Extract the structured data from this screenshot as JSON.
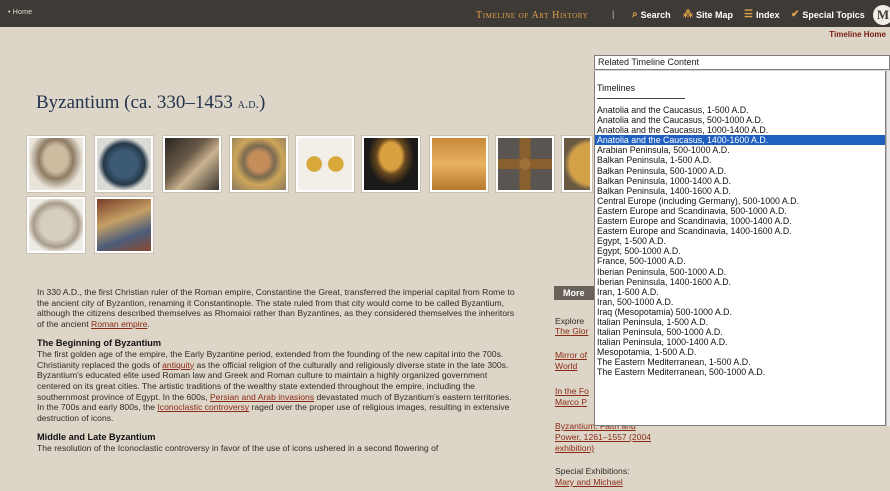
{
  "topbar": {
    "home": "• Home",
    "site_title": "Timeline of Art History",
    "separator": "|",
    "nav": [
      {
        "label": "Search",
        "icon": "⌕"
      },
      {
        "label": "Site Map",
        "icon": "⁂"
      },
      {
        "label": "Index",
        "icon": "☰"
      },
      {
        "label": "Special Topics",
        "icon": "✔"
      }
    ],
    "logo": "M",
    "timeline_home": "Timeline Home"
  },
  "title": {
    "main": "Byzantium (ca. 330–1453 ",
    "era": "a.d.",
    "close": ")"
  },
  "content": {
    "intro": {
      "a": "In 330 A.D., the first Christian ruler of the Roman empire, Constantine the Great, transferred the imperial capital from Rome to the ancient city of Byzantion, renaming it Constantinople. The state ruled from that city would come to be called Byzantium, although the citizens described themselves as Rhomaioi rather than Byzantines, as they considered themselves the inheritors of the ancient ",
      "link": "Roman empire",
      "b": "."
    },
    "section1": {
      "heading": "The Beginning of Byzantium",
      "a": "The first golden age of the empire, the Early Byzantine period, extended from the founding of the new capital into the 700s. Christianity replaced the gods of ",
      "link1": "antiquity",
      "b": " as the official religion of the culturally and religiously diverse state in the late 300s. Byzantium's educated elite used Roman law and Greek and Roman culture to maintain a highly organized government centered on its great cities. The artistic traditions of the wealthy state extended throughout the empire, including the southernmost province of Egypt. In the 600s, ",
      "link2": "Persian and Arab invasions",
      "c": " devastated much of Byzantium's eastern territories. In the 700s and early 800s, the ",
      "link3": "Iconoclastic controversy",
      "d": " raged over the proper use of religious images, resulting in extensive destruction of icons."
    },
    "section2": {
      "heading": "Middle and Late Byzantium",
      "a": "The resolution of the Iconoclastic controversy in favor of the use of icons ushered in a second flowering of"
    }
  },
  "right_column": {
    "more": "More",
    "explore": "Explore",
    "link_glory": "The Glor",
    "link_mirror": "Mirror of",
    "link_world": "World",
    "link_inthe": "In the Fo",
    "link_marco": "Marco P",
    "link_byz1": "Byzantium: Faith and",
    "link_byz2": "Power, 1261–1557 (2004",
    "link_byz3": "exhibition)",
    "special": "Special Exhibitions:",
    "link_mary": "Mary and Michael"
  },
  "dropdown": {
    "selected_value": "Related Timeline Content",
    "heading": "Timelines",
    "selected_index": 3,
    "options": [
      "Anatolia and the Caucasus, 1-500 A.D.",
      "Anatolia and the Caucasus, 500-1000 A.D.",
      "Anatolia and the Caucasus, 1000-1400 A.D.",
      "Anatolia and the Caucasus, 1400-1600 A.D.",
      "Arabian Peninsula, 500-1000 A.D.",
      "Balkan Peninsula, 1-500 A.D.",
      "Balkan Peninsula, 500-1000 A.D.",
      "Balkan Peninsula, 1000-1400 A.D.",
      "Balkan Peninsula, 1400-1600 A.D.",
      "Central Europe (including Germany), 500-1000 A.D.",
      "Eastern Europe and Scandinavia, 500-1000 A.D.",
      "Eastern Europe and Scandinavia, 1000-1400 A.D.",
      "Eastern Europe and Scandinavia, 1400-1600 A.D.",
      "Egypt, 1-500 A.D.",
      "Egypt, 500-1000 A.D.",
      "France, 500-1000 A.D.",
      "Iberian Peninsula, 500-1000 A.D.",
      "Iberian Peninsula, 1400-1600 A.D.",
      "Iran, 1-500 A.D.",
      "Iran, 500-1000 A.D.",
      "Iraq (Mesopotamia) 500-1000 A.D.",
      "Italian Peninsula, 1-500 A.D.",
      "Italian Peninsula, 500-1000 A.D.",
      "Italian Peninsula, 1000-1400 A.D.",
      "Mesopotamia, 1-500 A.D.",
      "The Eastern Mediterranean, 1-500 A.D.",
      "The Eastern Mediterranean, 500-1000 A.D."
    ]
  },
  "thumbnails": [
    {
      "icon": "portrait-head"
    },
    {
      "icon": "blue-pendant"
    },
    {
      "icon": "mosaic-panel"
    },
    {
      "icon": "saint-portrait"
    },
    {
      "icon": "gold-coins"
    },
    {
      "icon": "gold-chalice"
    },
    {
      "icon": "gold-icon-panel"
    },
    {
      "icon": "bronze-cross"
    },
    {
      "icon": "gold-medallion"
    },
    {
      "icon": "stone-capital"
    },
    {
      "icon": "painted-icon"
    }
  ]
}
